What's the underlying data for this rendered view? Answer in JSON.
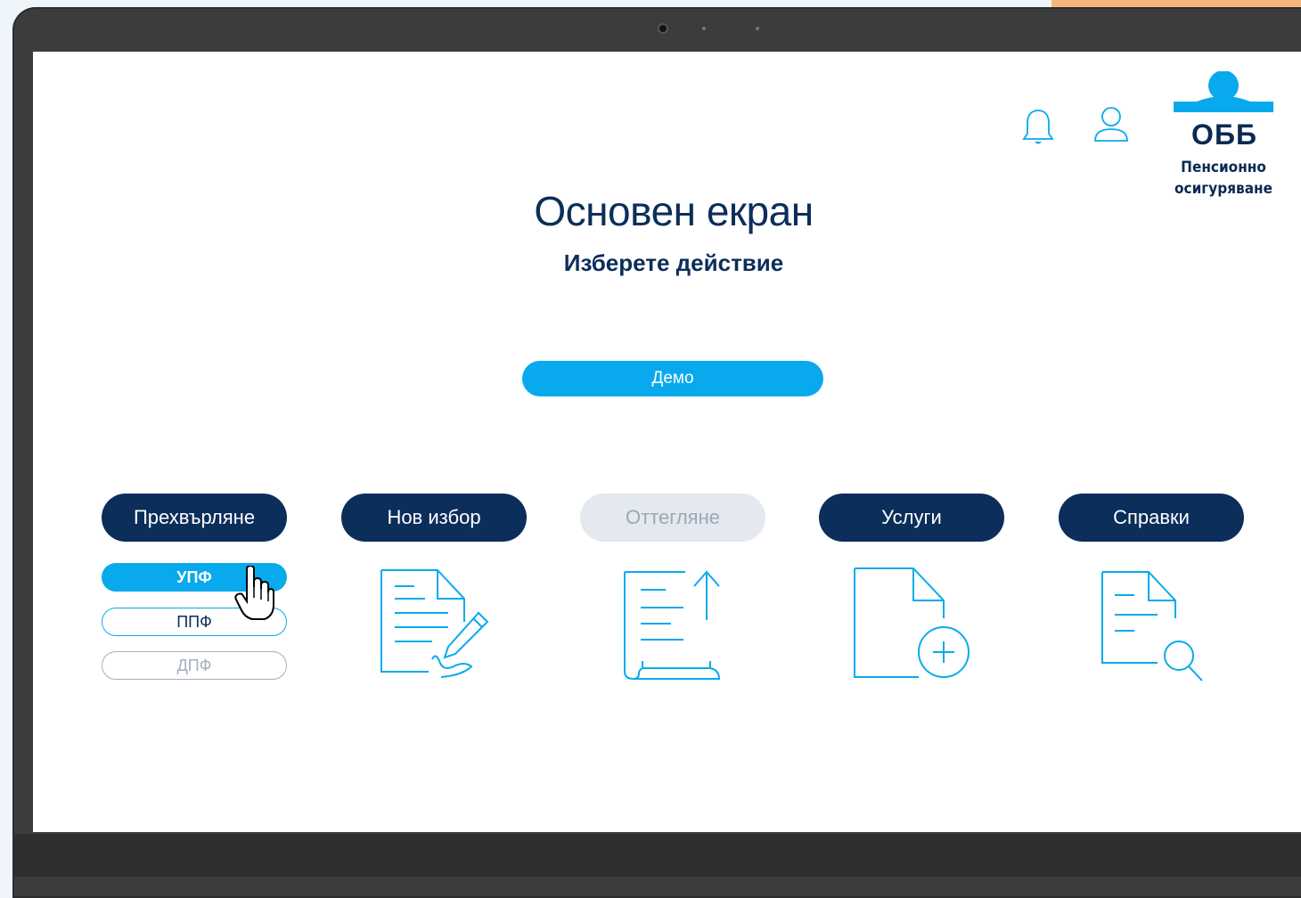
{
  "header": {
    "notifications_icon": "bell-icon",
    "profile_icon": "user-icon"
  },
  "logo": {
    "brand": "ОББ",
    "line1": "Пенсионно",
    "line2": "осигуряване"
  },
  "main": {
    "title": "Основен екран",
    "subtitle": "Изберете действие",
    "demo_label": "Демо"
  },
  "actions": [
    {
      "label": "Прехвърляне",
      "enabled": true
    },
    {
      "label": "Нов избор",
      "enabled": true
    },
    {
      "label": "Оттегляне",
      "enabled": false
    },
    {
      "label": "Услуги",
      "enabled": true
    },
    {
      "label": "Справки",
      "enabled": true
    }
  ],
  "funds": [
    {
      "label": "УПФ",
      "state": "selected"
    },
    {
      "label": "ППФ",
      "state": "normal"
    },
    {
      "label": "ДПФ",
      "state": "disabled"
    }
  ],
  "icons": {
    "new_choice": "document-sign-icon",
    "withdrawal": "scroll-upload-icon",
    "services": "document-add-icon",
    "reports": "document-search-icon",
    "cursor": "hand-pointer-icon"
  },
  "colors": {
    "navy": "#0b2e5a",
    "accent_blue": "#08aaed",
    "disabled_bg": "#e4e9ef",
    "disabled_text": "#9ba8b6"
  }
}
